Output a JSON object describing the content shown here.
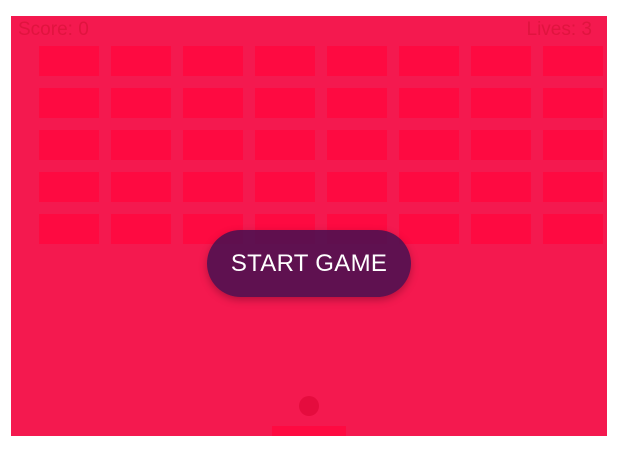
{
  "hud": {
    "score_label": "Score: 0",
    "lives_label": "Lives: 3"
  },
  "bricks": {
    "rows": 5,
    "columns_visible": 8,
    "color": "#fe0a41"
  },
  "start_button": {
    "label": "START GAME"
  },
  "colors": {
    "background": "#f4194f",
    "brick": "#fe0a41",
    "button": "#4a1052",
    "ball": "#e50c3e",
    "paddle": "#fe0a41"
  }
}
